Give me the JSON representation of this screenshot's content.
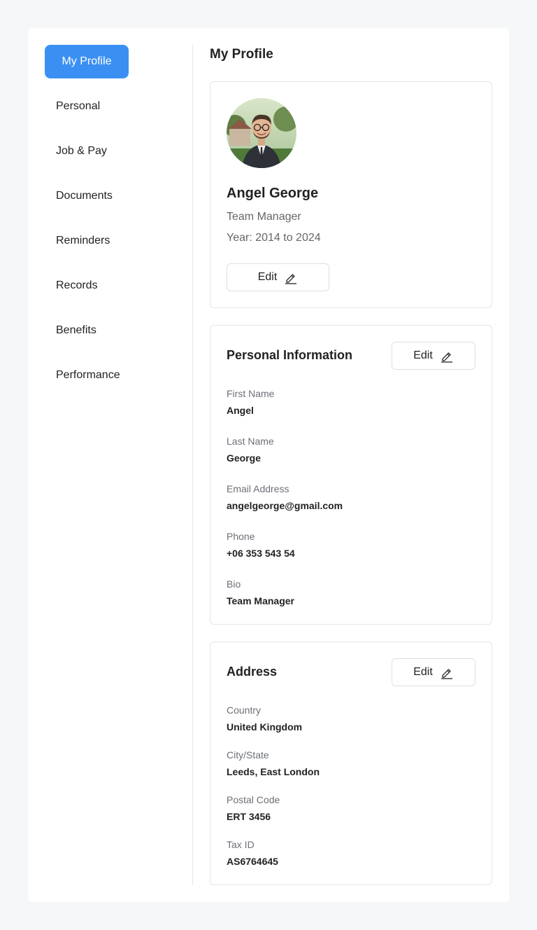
{
  "sidebar": {
    "items": [
      {
        "label": "My Profile",
        "active": true
      },
      {
        "label": "Personal"
      },
      {
        "label": "Job & Pay"
      },
      {
        "label": "Documents"
      },
      {
        "label": "Reminders"
      },
      {
        "label": "Records"
      },
      {
        "label": "Benefits"
      },
      {
        "label": "Performance"
      }
    ]
  },
  "main": {
    "title": "My Profile",
    "profile": {
      "name": "Angel George",
      "role": "Team Manager",
      "years": "Year: 2014 to 2024",
      "edit_label": "Edit"
    },
    "personal": {
      "heading": "Personal Information",
      "edit_label": "Edit",
      "fields": [
        {
          "label": "First Name",
          "value": "Angel"
        },
        {
          "label": "Last Name",
          "value": "George"
        },
        {
          "label": "Email Address",
          "value": "angelgeorge@gmail.com"
        },
        {
          "label": "Phone",
          "value": "+06 353 543 54"
        },
        {
          "label": "Bio",
          "value": "Team Manager"
        }
      ]
    },
    "address": {
      "heading": "Address",
      "edit_label": "Edit",
      "fields": [
        {
          "label": "Country",
          "value": "United Kingdom"
        },
        {
          "label": "City/State",
          "value": "Leeds, East London"
        },
        {
          "label": "Postal Code",
          "value": "ERT 3456"
        },
        {
          "label": "Tax ID",
          "value": "AS6764645"
        }
      ]
    }
  },
  "colors": {
    "accent": "#3b8ff3",
    "background": "#f6f7f9",
    "card_border": "#e4e6ea"
  },
  "icons": {
    "edit": "pencil-icon",
    "avatar": "user-photo"
  }
}
